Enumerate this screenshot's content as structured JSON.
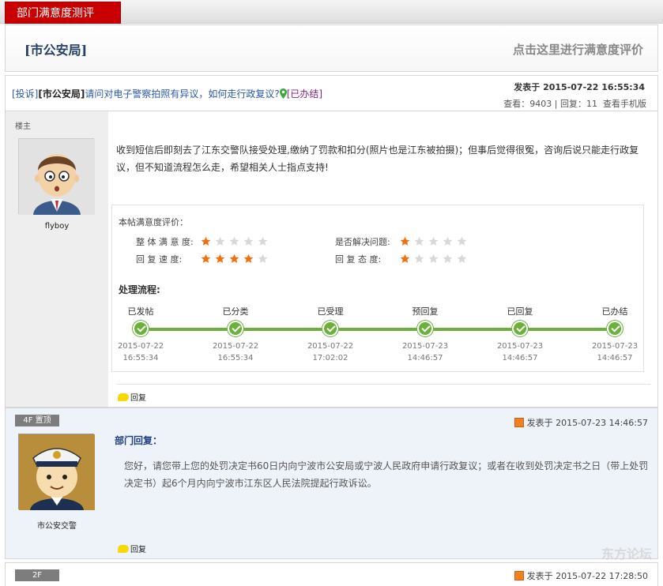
{
  "header": {
    "tab_label": "部门满意度测评"
  },
  "dept": {
    "name": "[市公安局]",
    "cta": "点击这里进行满意度评价"
  },
  "thread": {
    "tag": "[投诉]",
    "dept_tag": "[市公安局]",
    "title": "请问对电子警察拍照有异议，如何走行政复议?",
    "status": "[已办结]",
    "posted": "发表于 2015-07-22 16:55:34",
    "views_label": "查看：",
    "views": "9403",
    "sep": "|",
    "replies_label": "回复：",
    "replies": "11",
    "mobile_link": "查看手机版"
  },
  "post1": {
    "floor_label": "楼主",
    "username": "flyboy",
    "content": "收到短信后即刻去了江东交警队接受处理,缴纳了罚款和扣分(照片也是江东被拍摄)；但事后觉得很冤，咨询后说只能走行政复议，但不知道流程怎么走，希望相关人士指点支持!",
    "reply_label": "回复"
  },
  "rating": {
    "title": "本帖满意度评价：",
    "items": [
      {
        "label": "整 体 满 意 度:",
        "score": 1
      },
      {
        "label": "是否解决问题:",
        "score": 1
      },
      {
        "label": "回  复  速  度:",
        "score": 4
      },
      {
        "label": "回  复  态  度:",
        "score": 1
      }
    ],
    "max_score": 5,
    "flow_title": "处理流程:",
    "steps": [
      {
        "name": "已发帖",
        "date": "2015-07-22",
        "time": "16:55:34"
      },
      {
        "name": "已分类",
        "date": "2015-07-22",
        "time": "16:55:34"
      },
      {
        "name": "已受理",
        "date": "2015-07-22",
        "time": "17:02:02"
      },
      {
        "name": "预回复",
        "date": "2015-07-23",
        "time": "14:46:57"
      },
      {
        "name": "已回复",
        "date": "2015-07-23",
        "time": "14:46:57"
      },
      {
        "name": "已办结",
        "date": "2015-07-23",
        "time": "14:46:57"
      }
    ]
  },
  "post2": {
    "floor_badge": "4F 置顶",
    "posted": "发表于 2015-07-23 14:46:57",
    "username": "市公安交警",
    "reply_head": "部门回复：",
    "content": "您好，请您带上您的处罚决定书60日内向宁波市公安局或宁波人民政府申请行政复议；或者在收到处罚决定书之日（带上处罚决定书）起6个月内向宁波市江东区人民法院提起行政诉讼。",
    "reply_label": "回复"
  },
  "post3": {
    "floor_badge": "2F",
    "posted": "发表于 2015-07-22 17:28:50"
  },
  "watermark": "东方论坛",
  "colors": {
    "star_on": "#f07010",
    "star_off": "#d8d8d8",
    "flow_green": "#6ab03a",
    "brand_red": "#c80000"
  }
}
